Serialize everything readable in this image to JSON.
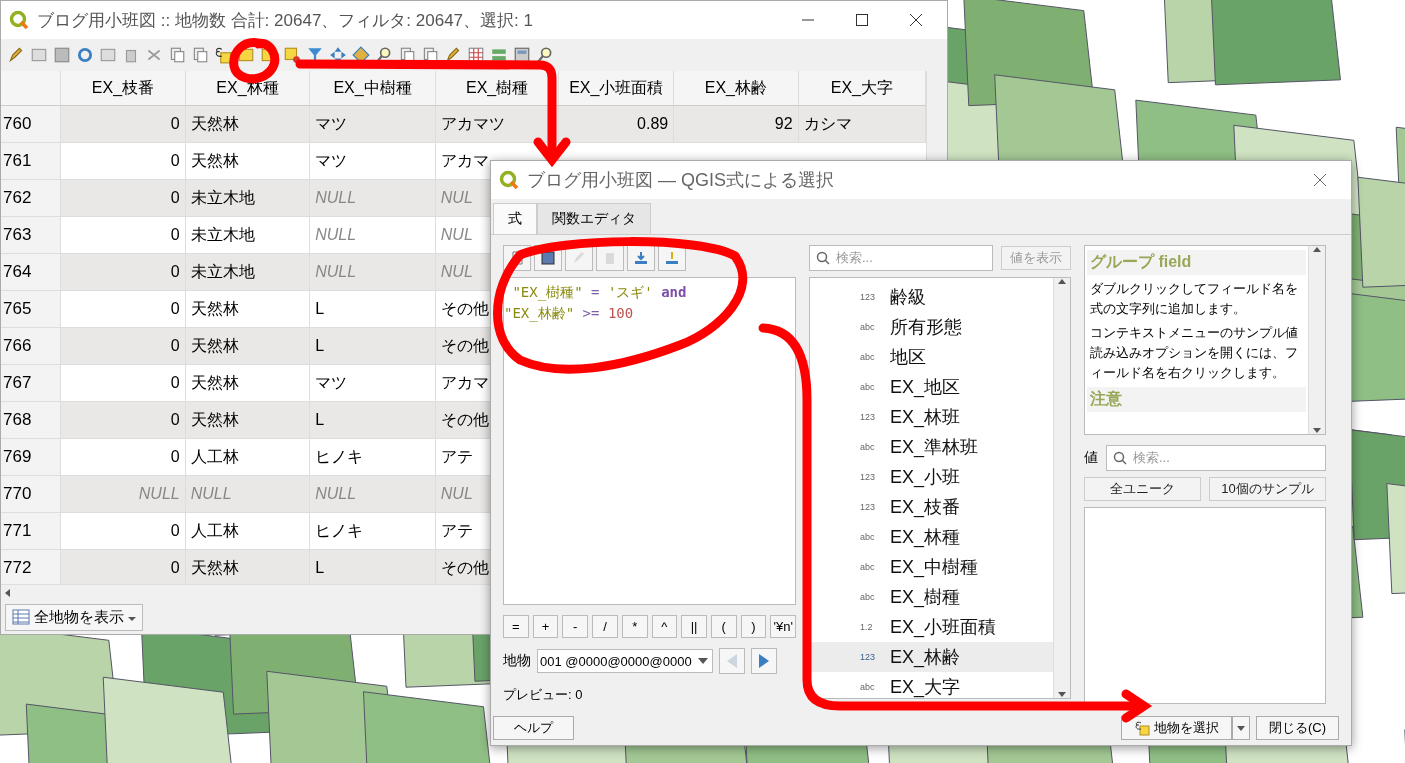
{
  "attribute_window": {
    "title": "ブログ用小班図 :: 地物数 合計: 20647、フィルタ: 20647、選択: 1",
    "columns": [
      {
        "label": "EX_枝番",
        "kind": "number"
      },
      {
        "label": "EX_林種",
        "kind": "text"
      },
      {
        "label": "EX_中樹種",
        "kind": "text"
      },
      {
        "label": "EX_樹種",
        "kind": "text"
      },
      {
        "label": "EX_小班面積",
        "kind": "number"
      },
      {
        "label": "EX_林齢",
        "kind": "number"
      },
      {
        "label": "EX_大字",
        "kind": "text"
      }
    ],
    "rows": [
      {
        "num": "760",
        "cells": [
          {
            "text": "0",
            "null": false
          },
          {
            "text": "天然林",
            "null": false
          },
          {
            "text": "マツ",
            "null": false
          },
          {
            "text": "アカマツ",
            "null": false
          },
          {
            "text": "0.89",
            "null": false
          },
          {
            "text": "92",
            "null": false
          },
          {
            "text": "カシマ",
            "null": false
          }
        ]
      },
      {
        "num": "761",
        "cells": [
          {
            "text": "0",
            "null": false
          },
          {
            "text": "天然林",
            "null": false
          },
          {
            "text": "マツ",
            "null": false
          },
          {
            "text": "アカマ",
            "null": false
          }
        ]
      },
      {
        "num": "762",
        "cells": [
          {
            "text": "0",
            "null": false
          },
          {
            "text": "未立木地",
            "null": false
          },
          {
            "text": "NULL",
            "null": true
          },
          {
            "text": "NUL",
            "null": true
          }
        ]
      },
      {
        "num": "763",
        "cells": [
          {
            "text": "0",
            "null": false
          },
          {
            "text": "未立木地",
            "null": false
          },
          {
            "text": "NULL",
            "null": true
          },
          {
            "text": "NUL",
            "null": true
          }
        ]
      },
      {
        "num": "764",
        "cells": [
          {
            "text": "0",
            "null": false
          },
          {
            "text": "未立木地",
            "null": false
          },
          {
            "text": "NULL",
            "null": true
          },
          {
            "text": "NUL",
            "null": true
          }
        ]
      },
      {
        "num": "765",
        "cells": [
          {
            "text": "0",
            "null": false
          },
          {
            "text": "天然林",
            "null": false
          },
          {
            "text": "L",
            "null": false
          },
          {
            "text": "その他",
            "null": false
          }
        ]
      },
      {
        "num": "766",
        "cells": [
          {
            "text": "0",
            "null": false
          },
          {
            "text": "天然林",
            "null": false
          },
          {
            "text": "L",
            "null": false
          },
          {
            "text": "その他",
            "null": false
          }
        ]
      },
      {
        "num": "767",
        "cells": [
          {
            "text": "0",
            "null": false
          },
          {
            "text": "天然林",
            "null": false
          },
          {
            "text": "マツ",
            "null": false
          },
          {
            "text": "アカマ",
            "null": false
          }
        ]
      },
      {
        "num": "768",
        "cells": [
          {
            "text": "0",
            "null": false
          },
          {
            "text": "天然林",
            "null": false
          },
          {
            "text": "L",
            "null": false
          },
          {
            "text": "その他",
            "null": false
          }
        ]
      },
      {
        "num": "769",
        "cells": [
          {
            "text": "0",
            "null": false
          },
          {
            "text": "人工林",
            "null": false
          },
          {
            "text": "ヒノキ",
            "null": false
          },
          {
            "text": "アテ",
            "null": false
          }
        ]
      },
      {
        "num": "770",
        "cells": [
          {
            "text": "NULL",
            "null": true
          },
          {
            "text": "NULL",
            "null": true
          },
          {
            "text": "NULL",
            "null": true
          },
          {
            "text": "NUL",
            "null": true
          }
        ]
      },
      {
        "num": "771",
        "cells": [
          {
            "text": "0",
            "null": false
          },
          {
            "text": "人工林",
            "null": false
          },
          {
            "text": "ヒノキ",
            "null": false
          },
          {
            "text": "アテ",
            "null": false
          }
        ]
      },
      {
        "num": "772",
        "cells": [
          {
            "text": "0",
            "null": false
          },
          {
            "text": "天然林",
            "null": false
          },
          {
            "text": "L",
            "null": false
          },
          {
            "text": "その他",
            "null": false
          }
        ]
      }
    ],
    "filter_button": "全地物を表示"
  },
  "dialog": {
    "title": "ブログ用小班図 — QGIS式による選択",
    "tabs": [
      {
        "label": "式",
        "selected": true
      },
      {
        "label": "関数エディタ",
        "selected": false
      }
    ],
    "expression_toolbar": [
      {
        "kind": "new",
        "disabled": false
      },
      {
        "kind": "save",
        "disabled": false
      },
      {
        "kind": "edit",
        "disabled": true
      },
      {
        "kind": "delete",
        "disabled": true
      },
      {
        "kind": "import",
        "disabled": false
      },
      {
        "kind": "export",
        "disabled": false
      }
    ],
    "expression_lines": [
      {
        "tokens": [
          {
            "kind": "field",
            "text": " \"EX_樹種\""
          },
          {
            "kind": "operator",
            "text": " = "
          },
          {
            "kind": "string",
            "text": "'スギ'"
          },
          {
            "kind": "keyword",
            "text": " and"
          }
        ]
      },
      {
        "tokens": [
          {
            "kind": "field",
            "text": "\"EX_林齢\""
          },
          {
            "kind": "operator",
            "text": " >= "
          },
          {
            "kind": "number",
            "text": "100"
          }
        ]
      }
    ],
    "operators": [
      "=",
      "+",
      "-",
      "/",
      "*",
      "^",
      "||",
      "(",
      ")",
      "'¥n'"
    ],
    "feature_label": "地物",
    "feature_value": "001 @0000@0000@0000",
    "feature_nav": [
      {
        "kind": "prev",
        "disabled": true
      },
      {
        "kind": "next",
        "disabled": false
      }
    ],
    "preview": "プレビュー: 0",
    "search_placeholder": "検索...",
    "show_values_button": {
      "label": "値を表示",
      "disabled": true
    },
    "fields": [
      {
        "type": "123",
        "name": "齢級",
        "selected": false
      },
      {
        "type": "abc",
        "name": "所有形態",
        "selected": false
      },
      {
        "type": "abc",
        "name": "地区",
        "selected": false
      },
      {
        "type": "abc",
        "name": "EX_地区",
        "selected": false
      },
      {
        "type": "123",
        "name": "EX_林班",
        "selected": false
      },
      {
        "type": "abc",
        "name": "EX_準林班",
        "selected": false
      },
      {
        "type": "123",
        "name": "EX_小班",
        "selected": false
      },
      {
        "type": "123",
        "name": "EX_枝番",
        "selected": false
      },
      {
        "type": "abc",
        "name": "EX_林種",
        "selected": false
      },
      {
        "type": "abc",
        "name": "EX_中樹種",
        "selected": false
      },
      {
        "type": "abc",
        "name": "EX_樹種",
        "selected": false
      },
      {
        "type": "1.2",
        "name": "EX_小班面積",
        "selected": false
      },
      {
        "type": "123",
        "name": "EX_林齢",
        "selected": true
      },
      {
        "type": "abc",
        "name": "EX_大字",
        "selected": false
      }
    ],
    "help_heading": "グループ field",
    "help_paragraphs": [
      "ダブルクリックしてフィールド名を式の文字列に追加します。",
      "コンテキストメニューのサンプル値読み込みオプションを開くには、フィールド名を右クリックします。"
    ],
    "help_note_heading": "注意",
    "values_label": "値",
    "values_placeholder": "検索...",
    "values_buttons": [
      "全ユニーク",
      "10個のサンプル"
    ],
    "help_button": "ヘルプ",
    "select_button": "地物を選択",
    "close_button": "閉じる(C)"
  }
}
